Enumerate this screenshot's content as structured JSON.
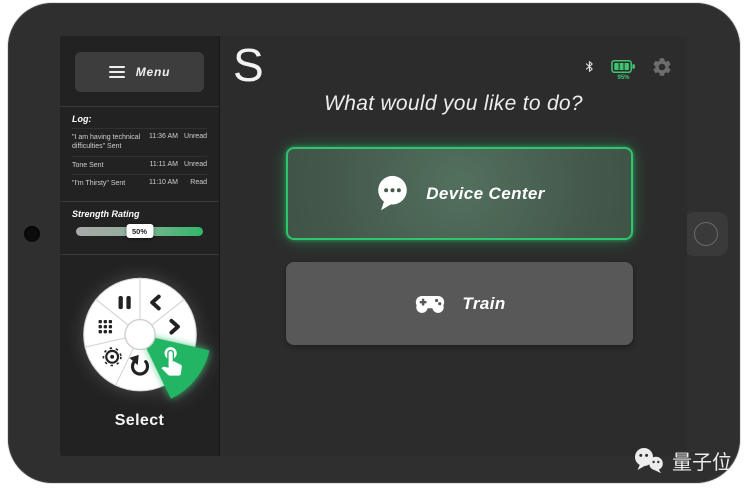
{
  "sidebar": {
    "menu_label": "Menu",
    "log": {
      "title": "Log:",
      "entries": [
        {
          "message": "\"I am having technical difficulties\" Sent",
          "time": "11:36 AM",
          "status": "Unread"
        },
        {
          "message": "Tone Sent",
          "time": "11:11 AM",
          "status": "Unread"
        },
        {
          "message": "\"I'm Thirsty\" Sent",
          "time": "11:10 AM",
          "status": "Read"
        }
      ]
    },
    "strength": {
      "label": "Strength Rating",
      "value_label": "50%",
      "value_percent": 50
    },
    "wheel": {
      "selected_label": "Select",
      "segments": [
        "pause",
        "previous",
        "next",
        "select",
        "undo",
        "target",
        "grid"
      ],
      "selected_segment": "select"
    }
  },
  "main": {
    "logo": "S",
    "heading": "What would you like to do?",
    "buttons": [
      {
        "label": "Device Center",
        "icon": "chat-bubble-icon",
        "state": "highlighted"
      },
      {
        "label": "Train",
        "icon": "game-controller-icon",
        "state": "default"
      }
    ],
    "status_bar": {
      "battery_percent": "95%",
      "icons": [
        "bluetooth-icon",
        "battery-icon",
        "settings-gear-icon"
      ]
    }
  },
  "watermark": {
    "text": "量子位",
    "icon": "wechat-icon"
  },
  "colors": {
    "accent_green": "#2fc46e",
    "screen_bg": "#2b2b2b",
    "sidebar_bg": "#222222",
    "button_gray": "#585858",
    "device_button_fill": "#44594c"
  }
}
